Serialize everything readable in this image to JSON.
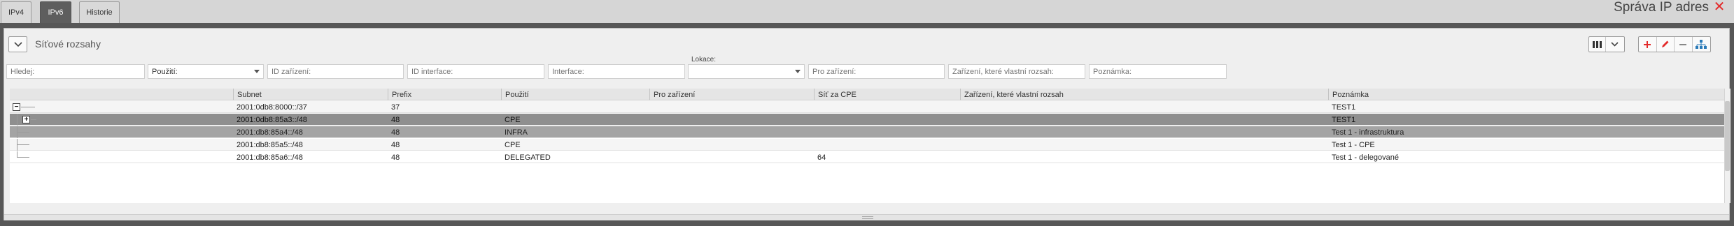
{
  "tabs": [
    {
      "label": "IPv4",
      "active": false
    },
    {
      "label": "IPv6",
      "active": true
    },
    {
      "label": "Historie",
      "active": false
    }
  ],
  "app_title": "Správa IP adres",
  "panel": {
    "title": "Síťové rozsahy"
  },
  "filters": {
    "search": "Hledej:",
    "usage": "Použití:",
    "device_id": "ID zařízení:",
    "interface_id": "ID interface:",
    "interface": "Interface:",
    "location_label": "Lokace:",
    "location_value": "",
    "for_device": "Pro zařízení:",
    "owner_device": "Zařízení, které vlastní rozsah:",
    "note": "Poznámka:"
  },
  "columns": {
    "subnet": "Subnet",
    "prefix": "Prefix",
    "usage": "Použití",
    "for_device": "Pro zařízení",
    "cpe_net": "Síť za CPE",
    "owner_device": "Zařízení, které vlastní rozsah",
    "note": "Poznámka"
  },
  "rows": [
    {
      "subnet": "2001:0db8:8000::/37",
      "prefix": "37",
      "usage": "",
      "for_device": "",
      "cpe_net": "",
      "owner_device": "",
      "note": "TEST1",
      "tree": "minus"
    },
    {
      "subnet": "2001:0db8:85a3::/48",
      "prefix": "48",
      "usage": "CPE",
      "for_device": "",
      "cpe_net": "",
      "owner_device": "",
      "note": "TEST1",
      "tree": "plus"
    },
    {
      "subnet": "2001:db8:85a4::/48",
      "prefix": "48",
      "usage": "INFRA",
      "for_device": "",
      "cpe_net": "",
      "owner_device": "",
      "note": "Test 1 - infrastruktura",
      "tree": "leaf"
    },
    {
      "subnet": "2001:db8:85a5::/48",
      "prefix": "48",
      "usage": "CPE",
      "for_device": "",
      "cpe_net": "",
      "owner_device": "",
      "note": "Test 1 - CPE",
      "tree": "leaf"
    },
    {
      "subnet": "2001:db8:85a6::/48",
      "prefix": "48",
      "usage": "DELEGATED",
      "for_device": "",
      "cpe_net": "64",
      "owner_device": "",
      "note": "Test 1 - delegované",
      "tree": "last"
    }
  ],
  "toolbar": {
    "columns_icon": "columns-icon",
    "dropdown_icon": "chevron-down-icon",
    "add_icon": "plus-icon",
    "edit_icon": "pencil-icon",
    "remove_icon": "minus-icon",
    "tree_icon": "hierarchy-icon"
  },
  "colors": {
    "accent_red": "#e32b2b",
    "frame": "#575757",
    "active_tab": "#5e5e5e",
    "selected_row": "#8f8f8f"
  }
}
